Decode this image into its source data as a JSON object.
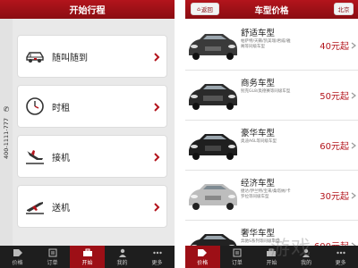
{
  "left_screen": {
    "title": "开始行程",
    "phone": "400-1111-777",
    "menu": [
      {
        "label": "随叫随到",
        "icon": "car-icon"
      },
      {
        "label": "时租",
        "icon": "clock-icon"
      },
      {
        "label": "接机",
        "icon": "plane-landing-icon"
      },
      {
        "label": "送机",
        "icon": "plane-takeoff-icon"
      }
    ],
    "tabs": [
      {
        "label": "价格",
        "icon": "tag-icon"
      },
      {
        "label": "订单",
        "icon": "list-icon"
      },
      {
        "label": "开始",
        "icon": "briefcase-icon",
        "active": true
      },
      {
        "label": "我的",
        "icon": "user-icon"
      },
      {
        "label": "更多",
        "icon": "more-icon"
      }
    ]
  },
  "right_screen": {
    "title": "车型价格",
    "back_label": "返回",
    "city_label": "北京",
    "cars": [
      {
        "name": "舒适车型",
        "desc": "帕萨特/天籁/凯美瑞/君威/雅阁等同级车型",
        "price": "40元起",
        "color": "#3a3a3a"
      },
      {
        "name": "商务车型",
        "desc": "别克GL8/奥德赛等同级车型",
        "price": "50元起",
        "color": "#2a2a2a"
      },
      {
        "name": "豪华车型",
        "desc": "奥迪A6L等同级车型",
        "price": "60元起",
        "color": "#1f1f1f"
      },
      {
        "name": "经济车型",
        "desc": "捷达/伊兰特/宝来/桑塔纳/卡罗拉等同级车型",
        "price": "30元起",
        "color": "#bdbdbd"
      },
      {
        "name": "奢华车型",
        "desc": "奔驰S系列等同级车型",
        "price": "600元起",
        "color": "#222222"
      }
    ],
    "tabs": [
      {
        "label": "价格",
        "icon": "tag-icon",
        "active": true
      },
      {
        "label": "订单",
        "icon": "list-icon"
      },
      {
        "label": "开始",
        "icon": "briefcase-icon"
      },
      {
        "label": "我的",
        "icon": "user-icon"
      },
      {
        "label": "更多",
        "icon": "more-icon"
      }
    ],
    "watermark": "游戏"
  },
  "colors": {
    "brand_red": "#b3141c",
    "tabbar": "#1e1e1e",
    "tab_active": "#9d0f16"
  }
}
